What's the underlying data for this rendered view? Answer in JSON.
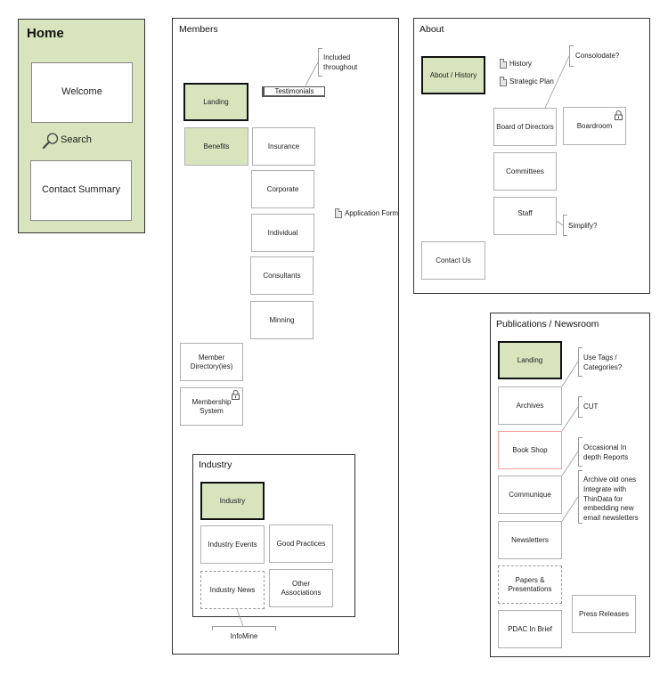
{
  "home": {
    "title": "Home",
    "welcome": "Welcome",
    "search": "Search",
    "contact_summary": "Contact Summary",
    "bg_color": "#d7e4bd"
  },
  "members": {
    "title": "Members",
    "landing": "Landing",
    "testimonials": "Testimonials",
    "testimonials_note": "Included throughout",
    "benefits": "Benefits",
    "benefit_items": [
      "Insurance",
      "Corporate",
      "Individual",
      "Consultants",
      "Minning"
    ],
    "application_form": "Application Form",
    "member_directory": "Member Directory(ies)",
    "membership_system": "Membership System",
    "industry": {
      "title": "Industry",
      "landing": "Industry",
      "events": "Industry Events",
      "good_practices": "Good Practices",
      "news": "Industry News",
      "other_associations": "Other Associations",
      "infomine": "InfoMine"
    }
  },
  "about": {
    "title": "About",
    "about_history": "About / History",
    "history_doc": "History",
    "strategic_plan_doc": "Strategic Plan",
    "consolidate_note": "Consolodate?",
    "board_of_directors": "Board of Directors",
    "boardroom": "Boardroom",
    "committees": "Committees",
    "staff": "Staff",
    "simplify_note": "Simplify?",
    "contact_us": "Contact Us"
  },
  "publications": {
    "title": "Publications / Newsroom",
    "landing": "Landing",
    "archives": "Archives",
    "archives_note": "Use Tags / Categories?",
    "book_shop": "Book Shop",
    "book_shop_note": "CUT",
    "communique": "Communique",
    "communique_note": "Occasional In depth Reports",
    "newsletters": "Newsletters",
    "newsletters_note": "Archive old ones Integrate with ThinData for embedding new email newsletters",
    "papers": "Papers & Presentations",
    "pdac_in_brief": "PDAC In Brief",
    "press_releases": "Press Releases"
  },
  "colors": {
    "landing_green": "#d7e4bd",
    "cut_red": "#f2a0a0"
  }
}
